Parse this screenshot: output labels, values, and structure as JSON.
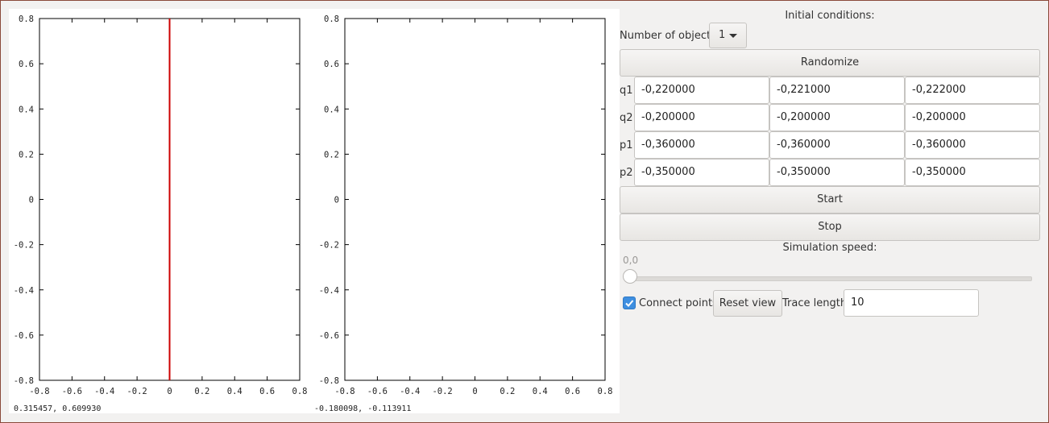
{
  "plots": [
    {
      "coord_readout": "0.315457,  0.609930",
      "x_ticks": [
        "-0.8",
        "-0.6",
        "-0.4",
        "-0.2",
        "0",
        "0.2",
        "0.4",
        "0.6",
        "0.8"
      ],
      "y_ticks": [
        "0.8",
        "0.6",
        "0.4",
        "0.2",
        "0",
        "-0.2",
        "-0.4",
        "-0.6",
        "-0.8"
      ],
      "xlim": [
        -0.8,
        0.8
      ],
      "ylim": [
        -0.8,
        0.8
      ],
      "vline_x": 0.0,
      "line_color": "#cc0000"
    },
    {
      "coord_readout": "-0.180098, -0.113911",
      "x_ticks": [
        "-0.8",
        "-0.6",
        "-0.4",
        "-0.2",
        "0",
        "0.2",
        "0.4",
        "0.6",
        "0.8"
      ],
      "y_ticks": [
        "0.8",
        "0.6",
        "0.4",
        "0.2",
        "0",
        "-0.2",
        "-0.4",
        "-0.6",
        "-0.8"
      ],
      "xlim": [
        -0.8,
        0.8
      ],
      "ylim": [
        -0.8,
        0.8
      ]
    }
  ],
  "panel": {
    "initial_conditions_label": "Initial conditions:",
    "num_objects_label": "Number of objects:",
    "num_objects_value": "1",
    "randomize_label": "Randomize",
    "rows": [
      {
        "label": "q1:",
        "values": [
          "-0,220000",
          "-0,221000",
          "-0,222000"
        ]
      },
      {
        "label": "q2:",
        "values": [
          "-0,200000",
          "-0,200000",
          "-0,200000"
        ]
      },
      {
        "label": "p1:",
        "values": [
          "-0,360000",
          "-0,360000",
          "-0,360000"
        ]
      },
      {
        "label": "p2:",
        "values": [
          "-0,350000",
          "-0,350000",
          "-0,350000"
        ]
      }
    ],
    "start_label": "Start",
    "stop_label": "Stop",
    "sim_speed_label": "Simulation speed:",
    "sim_speed_value": "0,0",
    "sim_speed_fraction": 0.0,
    "connect_points_label": "Connect points",
    "connect_points_checked": true,
    "reset_view_label": "Reset view",
    "trace_length_label": "Trace length:",
    "trace_length_value": "10",
    "accent_color": "#3d8ee0"
  }
}
